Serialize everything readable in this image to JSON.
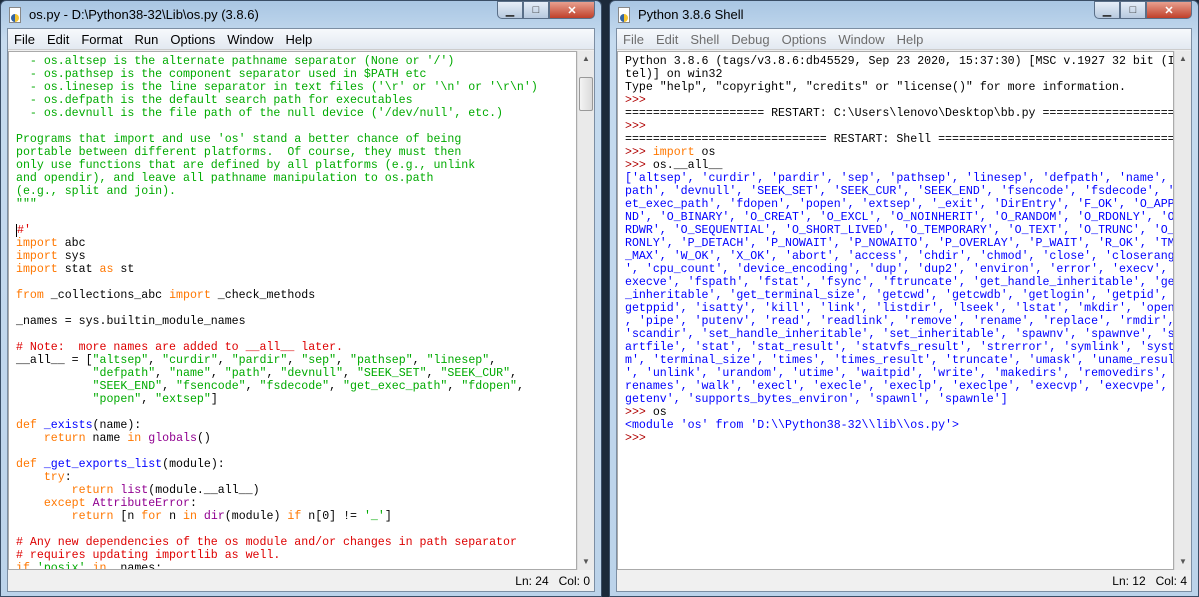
{
  "editor": {
    "title": "os.py - D:\\Python38-32\\Lib\\os.py (3.8.6)",
    "menu": [
      "File",
      "Edit",
      "Format",
      "Run",
      "Options",
      "Window",
      "Help"
    ],
    "status": {
      "ln": "Ln: 24",
      "col": "Col: 0"
    },
    "lines": [
      [
        [
          "g",
          "  - os.altsep is the alternate pathname separator (None or '/')"
        ]
      ],
      [
        [
          "g",
          "  - os.pathsep is the component separator used in $PATH etc"
        ]
      ],
      [
        [
          "g",
          "  - os.linesep is the line separator in text files ('\\r' or '\\n' or '\\r\\n')"
        ]
      ],
      [
        [
          "g",
          "  - os.defpath is the default search path for executables"
        ]
      ],
      [
        [
          "g",
          "  - os.devnull is the file path of the null device ('/dev/null', etc.)"
        ]
      ],
      [],
      [
        [
          "g",
          "Programs that import and use 'os' stand a better chance of being"
        ]
      ],
      [
        [
          "g",
          "portable between different platforms.  Of course, they must then"
        ]
      ],
      [
        [
          "g",
          "only use functions that are defined by all platforms (e.g., unlink"
        ]
      ],
      [
        [
          "g",
          "and opendir), and leave all pathname manipulation to os.path"
        ]
      ],
      [
        [
          "g",
          "(e.g., split and join)."
        ]
      ],
      [
        [
          "g",
          "\"\"\""
        ]
      ],
      [],
      [
        [
          "c",
          "#'"
        ]
      ],
      [
        [
          "k",
          "import"
        ],
        [
          "n",
          " abc"
        ]
      ],
      [
        [
          "k",
          "import"
        ],
        [
          "n",
          " sys"
        ]
      ],
      [
        [
          "k",
          "import"
        ],
        [
          "n",
          " stat "
        ],
        [
          "k",
          "as"
        ],
        [
          "n",
          " st"
        ]
      ],
      [],
      [
        [
          "k",
          "from"
        ],
        [
          "n",
          " _collections_abc "
        ],
        [
          "k",
          "import"
        ],
        [
          "n",
          " _check_methods"
        ]
      ],
      [],
      [
        [
          "n",
          "_names = sys.builtin_module_names"
        ]
      ],
      [],
      [
        [
          "c",
          "# Note:  more names are added to __all__ later."
        ]
      ],
      [
        [
          "n",
          "__all__ = ["
        ],
        [
          "g",
          "\"altsep\""
        ],
        [
          "n",
          ", "
        ],
        [
          "g",
          "\"curdir\""
        ],
        [
          "n",
          ", "
        ],
        [
          "g",
          "\"pardir\""
        ],
        [
          "n",
          ", "
        ],
        [
          "g",
          "\"sep\""
        ],
        [
          "n",
          ", "
        ],
        [
          "g",
          "\"pathsep\""
        ],
        [
          "n",
          ", "
        ],
        [
          "g",
          "\"linesep\""
        ],
        [
          "n",
          ","
        ]
      ],
      [
        [
          "n",
          "           "
        ],
        [
          "g",
          "\"defpath\""
        ],
        [
          "n",
          ", "
        ],
        [
          "g",
          "\"name\""
        ],
        [
          "n",
          ", "
        ],
        [
          "g",
          "\"path\""
        ],
        [
          "n",
          ", "
        ],
        [
          "g",
          "\"devnull\""
        ],
        [
          "n",
          ", "
        ],
        [
          "g",
          "\"SEEK_SET\""
        ],
        [
          "n",
          ", "
        ],
        [
          "g",
          "\"SEEK_CUR\""
        ],
        [
          "n",
          ","
        ]
      ],
      [
        [
          "n",
          "           "
        ],
        [
          "g",
          "\"SEEK_END\""
        ],
        [
          "n",
          ", "
        ],
        [
          "g",
          "\"fsencode\""
        ],
        [
          "n",
          ", "
        ],
        [
          "g",
          "\"fsdecode\""
        ],
        [
          "n",
          ", "
        ],
        [
          "g",
          "\"get_exec_path\""
        ],
        [
          "n",
          ", "
        ],
        [
          "g",
          "\"fdopen\""
        ],
        [
          "n",
          ","
        ]
      ],
      [
        [
          "n",
          "           "
        ],
        [
          "g",
          "\"popen\""
        ],
        [
          "n",
          ", "
        ],
        [
          "g",
          "\"extsep\""
        ],
        [
          "n",
          "]"
        ]
      ],
      [],
      [
        [
          "k",
          "def"
        ],
        [
          "n",
          " "
        ],
        [
          "d",
          "_exists"
        ],
        [
          "n",
          "(name):"
        ]
      ],
      [
        [
          "n",
          "    "
        ],
        [
          "k",
          "return"
        ],
        [
          "n",
          " name "
        ],
        [
          "k",
          "in"
        ],
        [
          "n",
          " "
        ],
        [
          "p",
          "globals"
        ],
        [
          "n",
          "()"
        ]
      ],
      [],
      [
        [
          "k",
          "def"
        ],
        [
          "n",
          " "
        ],
        [
          "d",
          "_get_exports_list"
        ],
        [
          "n",
          "(module):"
        ]
      ],
      [
        [
          "n",
          "    "
        ],
        [
          "k",
          "try"
        ],
        [
          "n",
          ":"
        ]
      ],
      [
        [
          "n",
          "        "
        ],
        [
          "k",
          "return"
        ],
        [
          "n",
          " "
        ],
        [
          "p",
          "list"
        ],
        [
          "n",
          "(module.__all__)"
        ]
      ],
      [
        [
          "n",
          "    "
        ],
        [
          "k",
          "except"
        ],
        [
          "n",
          " "
        ],
        [
          "p",
          "AttributeError"
        ],
        [
          "n",
          ":"
        ]
      ],
      [
        [
          "n",
          "        "
        ],
        [
          "k",
          "return"
        ],
        [
          "n",
          " [n "
        ],
        [
          "k",
          "for"
        ],
        [
          "n",
          " n "
        ],
        [
          "k",
          "in"
        ],
        [
          "n",
          " "
        ],
        [
          "p",
          "dir"
        ],
        [
          "n",
          "(module) "
        ],
        [
          "k",
          "if"
        ],
        [
          "n",
          " n[0] != "
        ],
        [
          "g",
          "'_'"
        ],
        [
          "n",
          "]"
        ]
      ],
      [],
      [
        [
          "c",
          "# Any new dependencies of the os module and/or changes in path separator"
        ]
      ],
      [
        [
          "c",
          "# requires updating importlib as well."
        ]
      ],
      [
        [
          "k",
          "if"
        ],
        [
          "n",
          " "
        ],
        [
          "g",
          "'posix'"
        ],
        [
          "n",
          " "
        ],
        [
          "k",
          "in"
        ],
        [
          "n",
          " _names:"
        ]
      ]
    ]
  },
  "shell": {
    "title": "Python 3.8.6 Shell",
    "menu": [
      "File",
      "Edit",
      "Shell",
      "Debug",
      "Options",
      "Window",
      "Help"
    ],
    "status": {
      "ln": "Ln: 12",
      "col": "Col: 4"
    },
    "lines": [
      [
        [
          "n",
          "Python 3.8.6 (tags/v3.8.6:db45529, Sep 23 2020, 15:37:30) [MSC v.1927 32 bit (In"
        ]
      ],
      [
        [
          "n",
          "tel)] on win32"
        ]
      ],
      [
        [
          "n",
          "Type \"help\", \"copyright\", \"credits\" or \"license()\" for more information."
        ]
      ],
      [
        [
          "pr",
          ">>> "
        ]
      ],
      [
        [
          "n",
          "==================== RESTART: C:\\Users\\lenovo\\Desktop\\bb.py ===================="
        ]
      ],
      [
        [
          "pr",
          ">>> "
        ]
      ],
      [
        [
          "n",
          "============================= RESTART: Shell ====================================="
        ]
      ],
      [
        [
          "pr",
          ">>> "
        ],
        [
          "k",
          "import"
        ],
        [
          "n",
          " os"
        ]
      ],
      [
        [
          "pr",
          ">>> "
        ],
        [
          "n",
          "os.__all__"
        ]
      ],
      [
        [
          "o",
          "['altsep', 'curdir', 'pardir', 'sep', 'pathsep', 'linesep', 'defpath', 'name', '"
        ]
      ],
      [
        [
          "o",
          "path', 'devnull', 'SEEK_SET', 'SEEK_CUR', 'SEEK_END', 'fsencode', 'fsdecode', 'g"
        ]
      ],
      [
        [
          "o",
          "et_exec_path', 'fdopen', 'popen', 'extsep', '_exit', 'DirEntry', 'F_OK', 'O_APPE"
        ]
      ],
      [
        [
          "o",
          "ND', 'O_BINARY', 'O_CREAT', 'O_EXCL', 'O_NOINHERIT', 'O_RANDOM', 'O_RDONLY', 'O_"
        ]
      ],
      [
        [
          "o",
          "RDWR', 'O_SEQUENTIAL', 'O_SHORT_LIVED', 'O_TEMPORARY', 'O_TEXT', 'O_TRUNC', 'O_W"
        ]
      ],
      [
        [
          "o",
          "RONLY', 'P_DETACH', 'P_NOWAIT', 'P_NOWAITO', 'P_OVERLAY', 'P_WAIT', 'R_OK', 'TMP"
        ]
      ],
      [
        [
          "o",
          "_MAX', 'W_OK', 'X_OK', 'abort', 'access', 'chdir', 'chmod', 'close', 'closerange"
        ]
      ],
      [
        [
          "o",
          "', 'cpu_count', 'device_encoding', 'dup', 'dup2', 'environ', 'error', 'execv', '"
        ]
      ],
      [
        [
          "o",
          "execve', 'fspath', 'fstat', 'fsync', 'ftruncate', 'get_handle_inheritable', 'get"
        ]
      ],
      [
        [
          "o",
          "_inheritable', 'get_terminal_size', 'getcwd', 'getcwdb', 'getlogin', 'getpid', '"
        ]
      ],
      [
        [
          "o",
          "getppid', 'isatty', 'kill', 'link', 'listdir', 'lseek', 'lstat', 'mkdir', 'open'"
        ]
      ],
      [
        [
          "o",
          ", 'pipe', 'putenv', 'read', 'readlink', 'remove', 'rename', 'replace', 'rmdir', "
        ]
      ],
      [
        [
          "o",
          "'scandir', 'set_handle_inheritable', 'set_inheritable', 'spawnv', 'spawnve', 'st"
        ]
      ],
      [
        [
          "o",
          "artfile', 'stat', 'stat_result', 'statvfs_result', 'strerror', 'symlink', 'syste"
        ]
      ],
      [
        [
          "o",
          "m', 'terminal_size', 'times', 'times_result', 'truncate', 'umask', 'uname_result"
        ]
      ],
      [
        [
          "o",
          "', 'unlink', 'urandom', 'utime', 'waitpid', 'write', 'makedirs', 'removedirs', '"
        ]
      ],
      [
        [
          "o",
          "renames', 'walk', 'execl', 'execle', 'execlp', 'execlpe', 'execvp', 'execvpe', '"
        ]
      ],
      [
        [
          "o",
          "getenv', 'supports_bytes_environ', 'spawnl', 'spawnle']"
        ]
      ],
      [
        [
          "pr",
          ">>> "
        ],
        [
          "n",
          "os"
        ]
      ],
      [
        [
          "o",
          "<module 'os' from 'D:\\\\Python38-32\\\\lib\\\\os.py'>"
        ]
      ],
      [
        [
          "pr",
          ">>> "
        ]
      ]
    ]
  },
  "colors": {
    "string": "#00aa00",
    "keyword": "#ff7700",
    "comment": "#dd0000",
    "builtin": "#900090",
    "definition": "#0000ff",
    "output": "#0000ff",
    "prompt": "#b00000"
  }
}
